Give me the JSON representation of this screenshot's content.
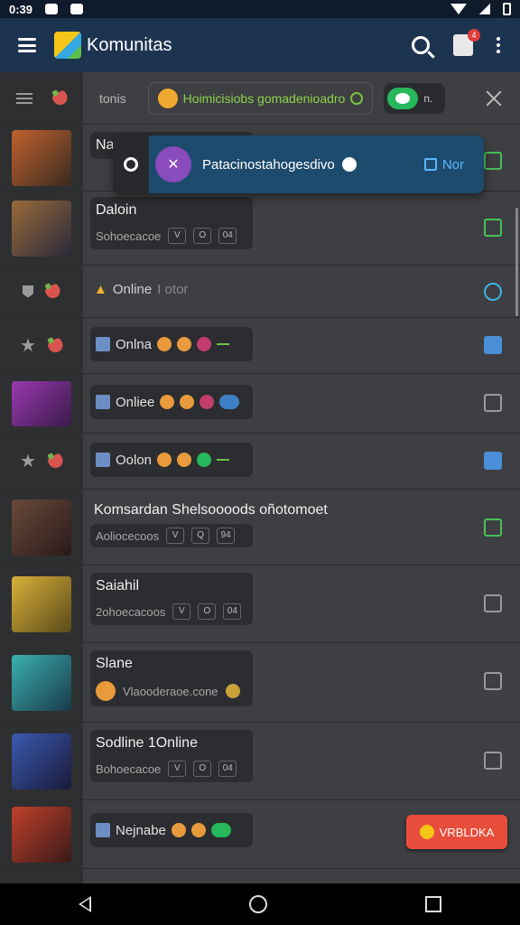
{
  "status_bar": {
    "time": "0:39"
  },
  "app_bar": {
    "title": "Komunitas",
    "notification_count": "4"
  },
  "filter_bar": {
    "label": "tonis",
    "chip_text": "Hoimicisiobs gomadenioadro",
    "toggle_text": "n."
  },
  "popup": {
    "text": "Patacinostahogesdivo",
    "action_label": "Nor"
  },
  "rows": [
    {
      "title": "Nar",
      "sub": "",
      "thumb": "#a0502a"
    },
    {
      "title": "Daloin",
      "sub": "Sohoecacoe",
      "buttons": [
        "V",
        "O",
        "04"
      ],
      "thumb": "#7a5a3a"
    },
    {
      "title": "Online",
      "subtitle_tail": "I otor"
    },
    {
      "title": "Onlna"
    },
    {
      "title": "Onliee",
      "thumb": "#7a2fa0"
    },
    {
      "title": "Oolon"
    },
    {
      "title": "Komsardan Shelsoooods oñotomoet",
      "sub": "Aoliocecoos",
      "buttons": [
        "V",
        "Q",
        "94"
      ],
      "thumb": "#5a3a2a"
    },
    {
      "title": "Saiahil",
      "sub": "2ohoecacoos",
      "buttons": [
        "V",
        "O",
        "04"
      ],
      "thumb": "#c9a23a"
    },
    {
      "title": "Slane",
      "sub": "Vlaooderaoe.cone",
      "thumb": "#3a8a8a"
    },
    {
      "title": "Sodline 1Online",
      "sub": "Bohoecacoe",
      "buttons": [
        "V",
        "O",
        "04"
      ],
      "thumb": "#2a4a8a"
    },
    {
      "title": "Nejnabe",
      "thumb": "#a03a3a"
    }
  ],
  "fab": {
    "label": "VRBLDKA"
  }
}
